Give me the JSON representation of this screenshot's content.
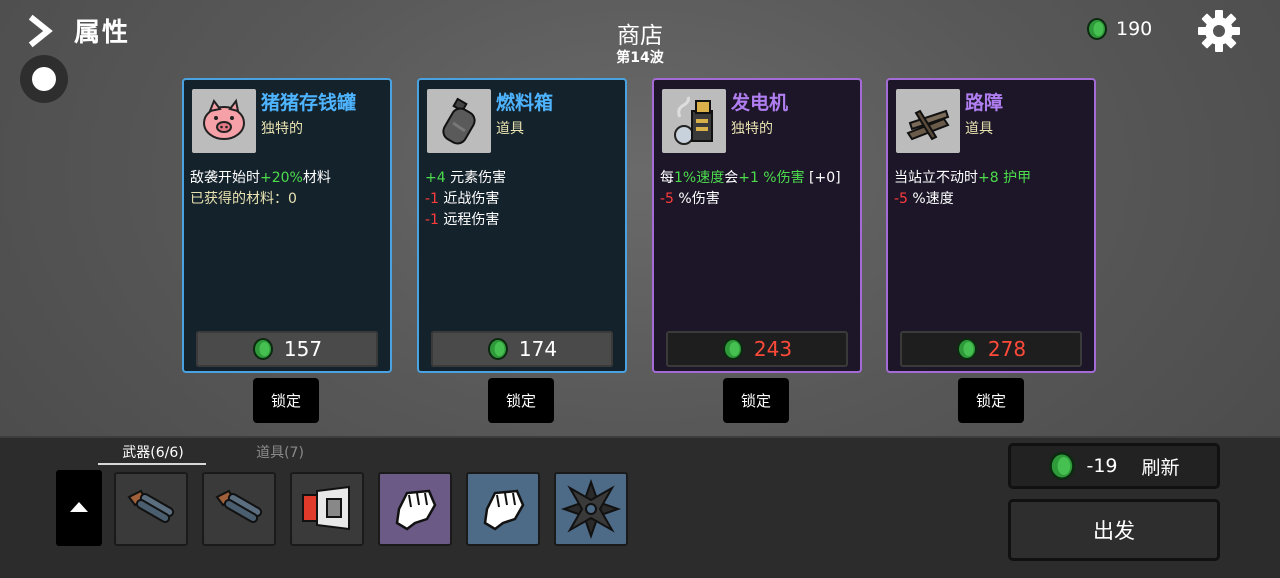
{
  "header": {
    "attributes_label": "属性",
    "shop_title": "商店",
    "wave_label": "第14波",
    "money": "190"
  },
  "colors": {
    "common_border": "#4aa3e0",
    "rare_border": "#a46ad6",
    "positive": "#4cdc4c",
    "negative": "#ff3b3b",
    "coin": "#2f9a3a"
  },
  "shop_items": [
    {
      "name": "猪猪存钱罐",
      "type": "独特的",
      "icon": "piggy-bank-icon",
      "desc": [
        {
          "parts": [
            {
              "t": "敌袭开始时",
              "c": ""
            },
            {
              "t": "+20%",
              "c": "g"
            },
            {
              "t": "材料",
              "c": ""
            }
          ]
        },
        {
          "parts": [
            {
              "t": "已获得的材料：0",
              "c": "y"
            }
          ]
        }
      ],
      "price": "157",
      "price_affordable": true,
      "lock_label": "锁定"
    },
    {
      "name": "燃料箱",
      "type": "道具",
      "icon": "fuel-tank-icon",
      "desc": [
        {
          "parts": [
            {
              "t": "+4",
              "c": "g"
            },
            {
              "t": " 元素伤害",
              "c": ""
            }
          ]
        },
        {
          "parts": [
            {
              "t": "-1",
              "c": "r"
            },
            {
              "t": " 近战伤害",
              "c": ""
            }
          ]
        },
        {
          "parts": [
            {
              "t": "-1",
              "c": "r"
            },
            {
              "t": " 远程伤害",
              "c": ""
            }
          ]
        }
      ],
      "price": "174",
      "price_affordable": true,
      "lock_label": "锁定"
    },
    {
      "name": "发电机",
      "type": "独特的",
      "icon": "generator-icon",
      "desc": [
        {
          "parts": [
            {
              "t": "每",
              "c": ""
            },
            {
              "t": "1%速度",
              "c": "g"
            },
            {
              "t": "会",
              "c": ""
            },
            {
              "t": "+1 %伤害",
              "c": "g"
            },
            {
              "t": " [+0]",
              "c": ""
            }
          ]
        },
        {
          "parts": [
            {
              "t": "-5",
              "c": "r"
            },
            {
              "t": " %伤害",
              "c": ""
            }
          ]
        }
      ],
      "price": "243",
      "price_affordable": false,
      "lock_label": "锁定"
    },
    {
      "name": "路障",
      "type": "道具",
      "icon": "barricade-icon",
      "desc": [
        {
          "parts": [
            {
              "t": "当站立不动时",
              "c": ""
            },
            {
              "t": "+8 护甲",
              "c": "g"
            }
          ]
        },
        {
          "parts": [
            {
              "t": "-5",
              "c": "r"
            },
            {
              "t": " %速度",
              "c": ""
            }
          ]
        }
      ],
      "price": "278",
      "price_affordable": false,
      "lock_label": "锁定"
    }
  ],
  "inventory": {
    "tab_weapons": "武器(6/6)",
    "tab_items": "道具(7)",
    "slots": [
      {
        "icon": "double-barrel-shotgun-icon",
        "tier": "grey"
      },
      {
        "icon": "double-barrel-shotgun-icon",
        "tier": "grey"
      },
      {
        "icon": "megaphone-turret-icon",
        "tier": "grey"
      },
      {
        "icon": "fist-icon",
        "tier": "purple"
      },
      {
        "icon": "fist-icon",
        "tier": "blue"
      },
      {
        "icon": "shuriken-icon",
        "tier": "blue"
      }
    ]
  },
  "actions": {
    "reroll_cost": "-19",
    "reroll_label": "刷新",
    "go_label": "出发"
  }
}
